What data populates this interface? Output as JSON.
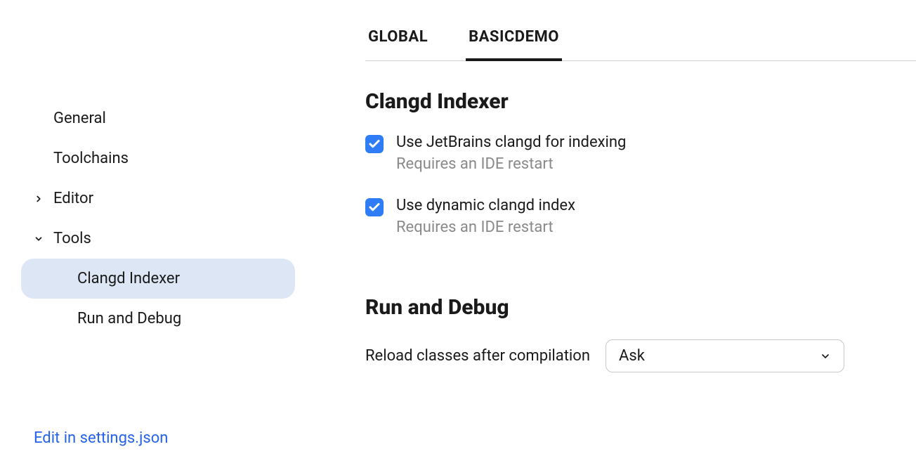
{
  "sidebar": {
    "items": [
      {
        "label": "General",
        "indent": 0,
        "hasChevron": false
      },
      {
        "label": "Toolchains",
        "indent": 0,
        "hasChevron": false
      },
      {
        "label": "Editor",
        "indent": 0,
        "hasChevron": true,
        "expanded": false
      },
      {
        "label": "Tools",
        "indent": 0,
        "hasChevron": true,
        "expanded": true
      },
      {
        "label": "Clangd Indexer",
        "indent": 1,
        "hasChevron": false,
        "selected": true
      },
      {
        "label": "Run and Debug",
        "indent": 1,
        "hasChevron": false
      }
    ],
    "footer_link": "Edit in settings.json"
  },
  "tabs": [
    {
      "label": "GLOBAL",
      "active": false
    },
    {
      "label": "BASICDEMO",
      "active": true
    }
  ],
  "section1": {
    "title": "Clangd Indexer",
    "checkbox1": {
      "label": "Use JetBrains clangd for indexing",
      "sublabel": "Requires an IDE restart",
      "checked": true
    },
    "checkbox2": {
      "label": "Use dynamic clangd index",
      "sublabel": "Requires an IDE restart",
      "checked": true
    }
  },
  "section2": {
    "title": "Run and Debug",
    "field1": {
      "label": "Reload classes after compilation",
      "value": "Ask"
    }
  }
}
